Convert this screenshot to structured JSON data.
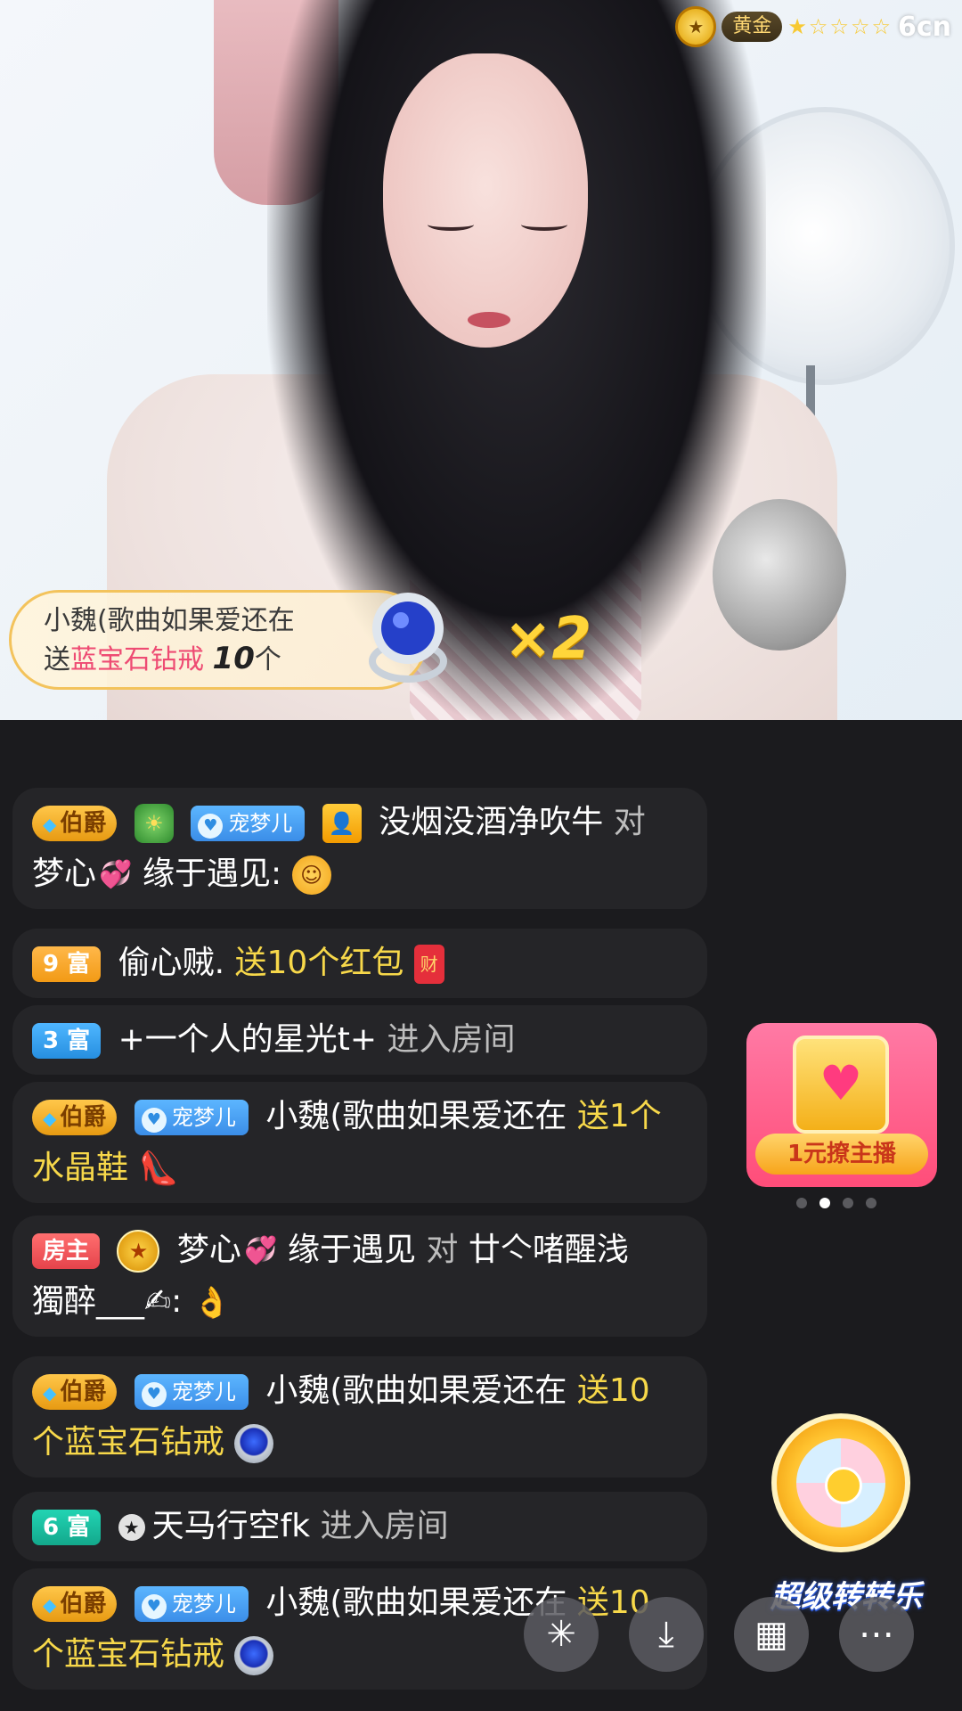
{
  "video": {
    "rank_label": "黄金",
    "rank_stars": "★☆☆☆☆",
    "site_logo": "6cn"
  },
  "gift_banner": {
    "sender": "小魏(歌曲如果爱还在",
    "send_word": "送",
    "gift_name": "蓝宝石钻戒",
    "count": "10",
    "unit": "个",
    "multiplier": "×2"
  },
  "chat": {
    "messages": [
      {
        "badge": "伯爵",
        "pet": "宠梦儿",
        "user": "没烟没酒净吹牛",
        "to_word": "对",
        "target": "梦心",
        "target_tail": "缘于遇见:"
      },
      {
        "badge": "9 富",
        "user": "偷心贼.",
        "action": "送10个红包",
        "icon_text": "财"
      },
      {
        "badge": "3 富",
        "user": "+一个人的星光t+",
        "action": "进入房间"
      },
      {
        "badge": "伯爵",
        "pet": "宠梦儿",
        "user": "小魏(歌曲如果爱还在",
        "action_a": "送1个",
        "action_b": "水晶鞋"
      },
      {
        "badge": "房主",
        "user": "梦心",
        "user_tail": "缘于遇见",
        "to_word": "对",
        "target": "廿亽啫醒浅",
        "target_tail": "獨醉___✍:"
      },
      {
        "badge": "伯爵",
        "pet": "宠梦儿",
        "user": "小魏(歌曲如果爱还在",
        "action_a": "送10",
        "action_b": "个蓝宝石钻戒"
      },
      {
        "badge": "6 富",
        "user": "天马行空fk",
        "action": "进入房间"
      },
      {
        "badge": "伯爵",
        "pet": "宠梦儿",
        "user": "小魏(歌曲如果爱还在",
        "action_a": "送10",
        "action_b": "个蓝宝石钻戒"
      }
    ]
  },
  "promo": {
    "label": "1元撩主播",
    "active_page": 2,
    "pages": 4
  },
  "wheel": {
    "label": "超级转转乐"
  },
  "colors": {
    "chat_bg": "#1b1b1e",
    "bubble_bg": "#252528",
    "highlight": "#f7d84a",
    "gift_pink": "#ee4b73"
  }
}
